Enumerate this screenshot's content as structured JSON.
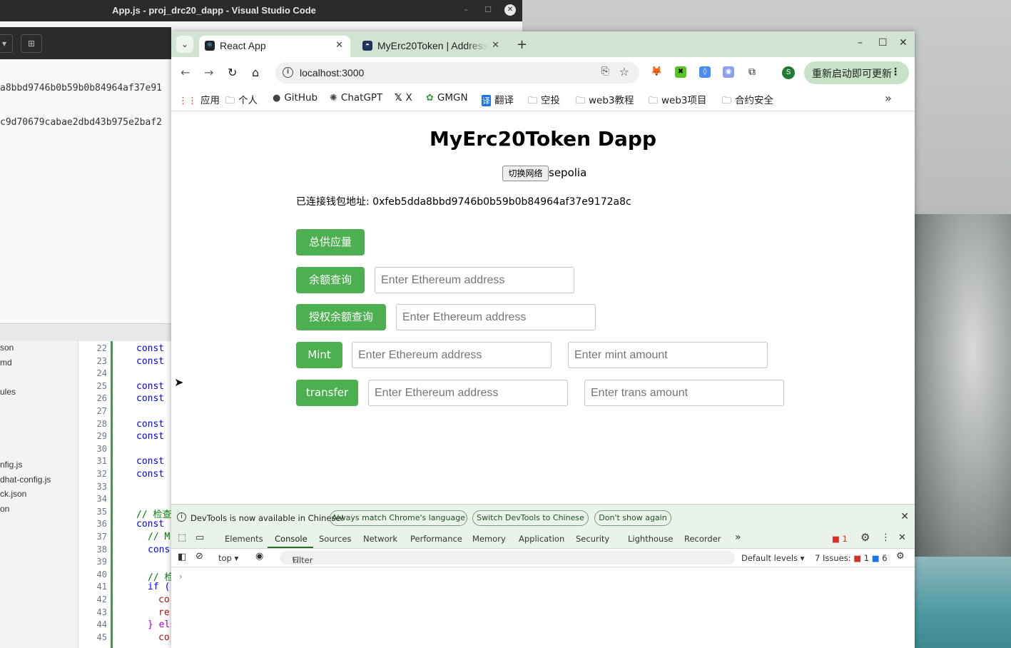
{
  "vscode": {
    "title": "App.js - proj_drc20_dapp - Visual Studio Code",
    "terminal_lines": [
      "a8bbd9746b0b59b0b84964af37e91",
      "c9d70679cabae2dbd43b975e2baf2"
    ],
    "explorer_files": [
      "son",
      "md",
      "ules",
      "nfig.js",
      "dhat-config.js",
      "ck.json",
      "on"
    ],
    "line_numbers": [
      "22",
      "23",
      "24",
      "25",
      "26",
      "27",
      "28",
      "29",
      "30",
      "31",
      "32",
      "33",
      "34",
      "35",
      "36",
      "37",
      "38",
      "39",
      "40",
      "41",
      "42",
      "43",
      "44",
      "45"
    ],
    "code_lines": [
      "const",
      "const",
      "",
      "const",
      "const",
      "",
      "const",
      "const",
      "",
      "const",
      "const",
      "",
      "",
      "// 检查",
      "const",
      "// M",
      "cons",
      "",
      "// 检",
      "if (",
      "co",
      "re",
      "} els",
      "co"
    ]
  },
  "chrome": {
    "tabs": [
      {
        "title": "React App",
        "close": "✕"
      },
      {
        "title": "MyErc20Token | Address",
        "close": "✕"
      }
    ],
    "new_tab": "+",
    "window_buttons": {
      "minimize": "–",
      "maximize": "☐",
      "close": "✕"
    },
    "url": "localhost:3000",
    "profile_initial": "S",
    "update_button": "重新启动即可更新",
    "bookmarks": [
      {
        "label": "应用",
        "icon": "apps-grid-icon"
      },
      {
        "label": "个人",
        "icon": "folder-icon"
      },
      {
        "label": "GitHub",
        "icon": "github-icon"
      },
      {
        "label": "ChatGPT",
        "icon": "chatgpt-icon"
      },
      {
        "label": "X",
        "icon": "x-logo-icon"
      },
      {
        "label": "GMGN",
        "icon": "gmgn-icon"
      },
      {
        "label": "翻译",
        "icon": "translate-icon"
      },
      {
        "label": "空投",
        "icon": "folder-icon"
      },
      {
        "label": "web3教程",
        "icon": "folder-icon"
      },
      {
        "label": "web3项目",
        "icon": "folder-icon"
      },
      {
        "label": "合约安全",
        "icon": "folder-icon"
      }
    ],
    "bookmarks_overflow": "»"
  },
  "page": {
    "title": "MyErc20Token Dapp",
    "switch_network_label": "切换网络",
    "network": "sepolia",
    "wallet_label": "已连接钱包地址: 0xfeb5dda8bbd9746b0b59b0b84964af37e9172a8c",
    "total_supply_button": "总供应量",
    "balance_button": "余额查询",
    "allowance_button": "授权余额查询",
    "mint_button": "Mint",
    "transfer_button": "transfer",
    "address_placeholder": "Enter Ethereum address",
    "mint_amount_placeholder": "Enter mint amount",
    "trans_amount_placeholder": "Enter trans amount",
    "button_color": "#4caf50"
  },
  "devtools": {
    "banner_message": "DevTools is now available in Chinese!",
    "banner_buttons": [
      "Always match Chrome's language",
      "Switch DevTools to Chinese",
      "Don't show again"
    ],
    "tabs": [
      "Elements",
      "Console",
      "Sources",
      "Network",
      "Performance",
      "Memory",
      "Application",
      "Security",
      "Lighthouse",
      "Recorder"
    ],
    "more_tabs": "»",
    "error_count": "1",
    "context": "top",
    "filter_placeholder": "Filter",
    "log_levels": "Default levels",
    "issues_label": "7 Issues:",
    "issues_errors": "1",
    "issues_info": "6",
    "prompt": "›"
  }
}
